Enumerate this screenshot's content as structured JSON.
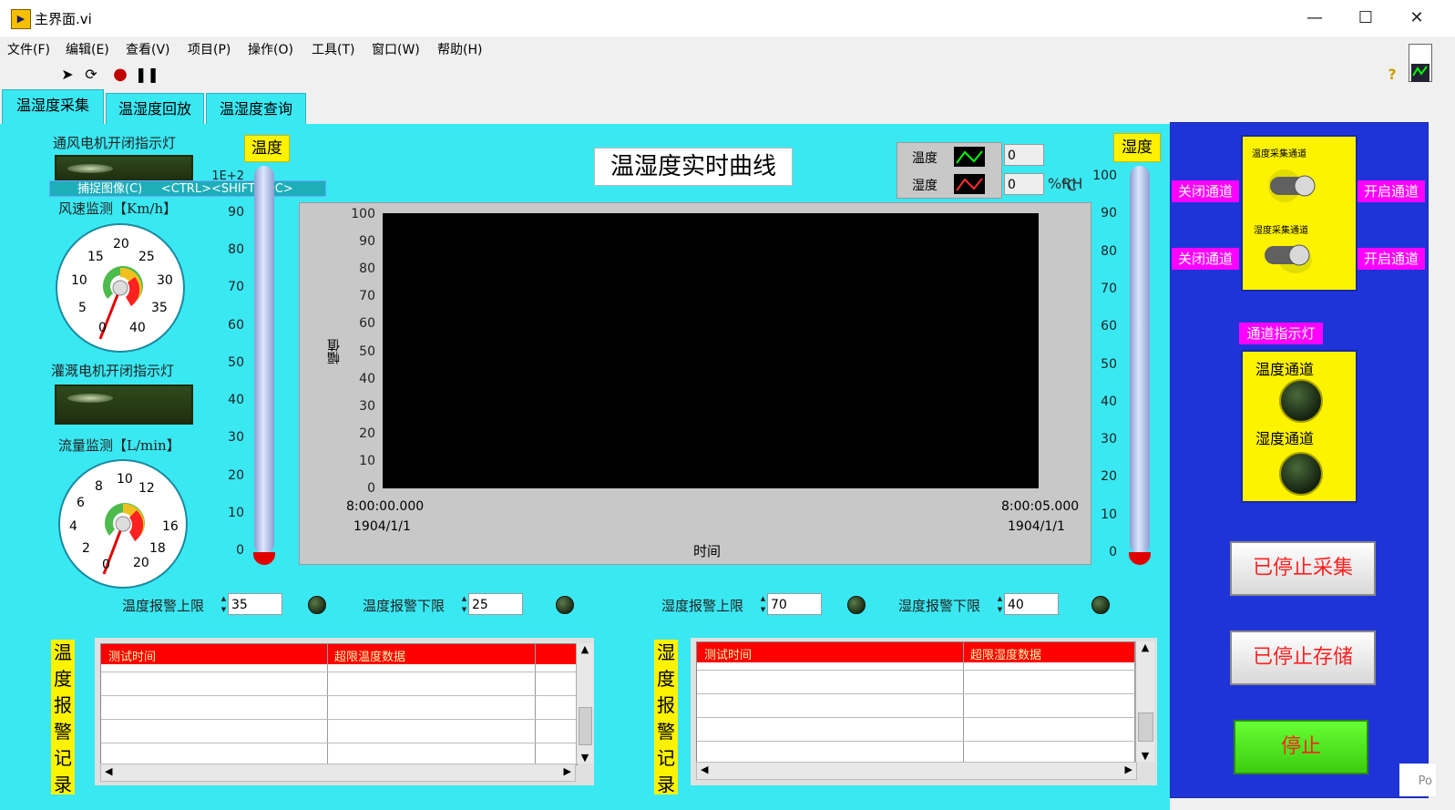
{
  "window": {
    "title": "主界面.vi",
    "app_icon_text": "▶"
  },
  "menu": [
    "文件(F)",
    "编辑(E)",
    "查看(V)",
    "项目(P)",
    "操作(O)",
    "工具(T)",
    "窗口(W)",
    "帮助(H)"
  ],
  "tabs": [
    "温湿度采集",
    "温湿度回放",
    "温湿度查询"
  ],
  "left": {
    "fan_label": "通风电机开闭指示灯",
    "capture_menu": "捕捉图像(C)     <CTRL><SHIFT><C>",
    "wind_label": "风速监测【Km/h】",
    "wind_ticks": [
      "0",
      "5",
      "10",
      "15",
      "20",
      "25",
      "30",
      "35",
      "40"
    ],
    "irrig_label": "灌溉电机开闭指示灯",
    "flow_label": "流量监测【L/min】",
    "flow_ticks": [
      "0",
      "2",
      "4",
      "6",
      "8",
      "10",
      "12",
      "16",
      "18",
      "20"
    ]
  },
  "temp_gauge": {
    "title": "温度",
    "top_label": "1E+2",
    "ticks": [
      "90",
      "80",
      "70",
      "60",
      "50",
      "40",
      "30",
      "20",
      "10",
      "0"
    ]
  },
  "hum_gauge": {
    "title": "湿度",
    "ticks": [
      "100",
      "90",
      "80",
      "70",
      "60",
      "50",
      "40",
      "30",
      "20",
      "10",
      "0"
    ]
  },
  "graph": {
    "title": "温湿度实时曲线",
    "legend": [
      {
        "name": "温度",
        "value": "0",
        "color": "#00ff00"
      },
      {
        "name": "湿度",
        "value": "0",
        "color": "#ff3030"
      }
    ],
    "unit_c": "℃",
    "unit_rh": "%RH",
    "ylabel": "幅值",
    "xlabel": "时间",
    "yticks": [
      "100",
      "90",
      "80",
      "70",
      "60",
      "50",
      "40",
      "30",
      "20",
      "10",
      "0"
    ],
    "x_start_time": "8:00:00.000",
    "x_start_date": "1904/1/1",
    "x_end_time": "8:00:05.000",
    "x_end_date": "1904/1/1"
  },
  "alarms": [
    {
      "label": "温度报警上限",
      "value": "35"
    },
    {
      "label": "温度报警下限",
      "value": "25"
    },
    {
      "label": "湿度报警上限",
      "value": "70"
    },
    {
      "label": "湿度报警下限",
      "value": "40"
    }
  ],
  "temp_table": {
    "title": "温度报警记录",
    "col1": "测试时间",
    "col2": "超限温度数据"
  },
  "hum_table": {
    "title": "湿度报警记录",
    "col1": "测试时间",
    "col2": "超限湿度数据"
  },
  "right": {
    "close1": "关闭通道",
    "open1": "开启通道",
    "close2": "关闭通道",
    "open2": "开启通道",
    "switch1_label": "温度采集通道",
    "switch2_label": "湿度采集通道",
    "indicator_title": "通道指示灯",
    "ind_temp": "温度通道",
    "ind_hum": "湿度通道",
    "btn_acq": "已停止采集",
    "btn_store": "已停止存储",
    "btn_stop": "停止"
  },
  "corner_text": "Po"
}
